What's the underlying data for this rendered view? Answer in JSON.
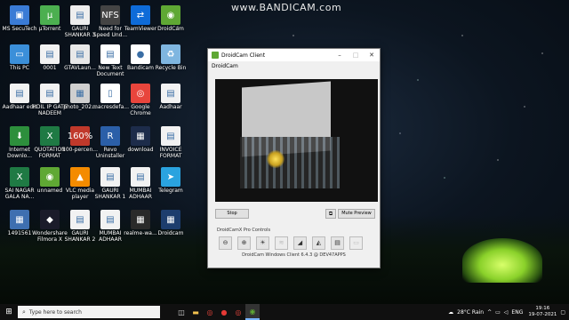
{
  "watermark": "www.BANDICAM.com",
  "desktop_icons": [
    {
      "label": "MS SecuTech",
      "icon": "ms-secutech-icon",
      "color": "#3a7bd5",
      "glyph": "▣"
    },
    {
      "label": "µTorrent",
      "icon": "utorrent-icon",
      "color": "#4caf50",
      "glyph": "µ"
    },
    {
      "label": "GAURI SHANKAR 3",
      "icon": "document-icon",
      "color": "#eeeeee",
      "glyph": "▤"
    },
    {
      "label": "Need for Speed Und...",
      "icon": "game-icon",
      "color": "#444444",
      "glyph": "NFS"
    },
    {
      "label": "TeamViewer",
      "icon": "teamviewer-icon",
      "color": "#0e6bd8",
      "glyph": "⇄"
    },
    {
      "label": "DroidCam",
      "icon": "droidcam-icon",
      "color": "#5fa834",
      "glyph": "◉"
    },
    {
      "label": "This PC",
      "icon": "computer-icon",
      "color": "#3b8fd9",
      "glyph": "▭"
    },
    {
      "label": "0001",
      "icon": "image-icon",
      "color": "#f2f2f2",
      "glyph": "▤"
    },
    {
      "label": "GTAVLaun...",
      "icon": "gtav-icon",
      "color": "#e8e8e8",
      "glyph": "▤"
    },
    {
      "label": "New Text Document",
      "icon": "text-file-icon",
      "color": "#ffffff",
      "glyph": "▤"
    },
    {
      "label": "Bandicam",
      "icon": "bandicam-icon",
      "color": "#ffffff",
      "glyph": "●"
    },
    {
      "label": "Recycle Bin",
      "icon": "recycle-bin-icon",
      "color": "#7fb6e0",
      "glyph": "♻"
    },
    {
      "label": "Aadhaar edit",
      "icon": "document-icon",
      "color": "#f2f2f2",
      "glyph": "▤"
    },
    {
      "label": "HDIL IP GATE NADEEM",
      "icon": "document-icon",
      "color": "#f2f2f2",
      "glyph": "▤"
    },
    {
      "label": "photo_202...",
      "icon": "photo-icon",
      "color": "#cfcfcf",
      "glyph": "▦"
    },
    {
      "label": "macresdefa...",
      "icon": "file-icon",
      "color": "#ffffff",
      "glyph": "▯"
    },
    {
      "label": "Google Chrome",
      "icon": "chrome-icon",
      "color": "#e8453c",
      "glyph": "◎"
    },
    {
      "label": "Aadhaar",
      "icon": "document-icon",
      "color": "#f2f2f2",
      "glyph": "▤"
    },
    {
      "label": "Internet Downlo...",
      "icon": "idm-icon",
      "color": "#2d8f3c",
      "glyph": "⬇"
    },
    {
      "label": "QUOTATION FORMAT",
      "icon": "excel-icon",
      "color": "#1f7a44",
      "glyph": "X"
    },
    {
      "label": "100-percen...",
      "icon": "image-icon",
      "color": "#c0392b",
      "glyph": "160%"
    },
    {
      "label": "Revo Uninstaller",
      "icon": "revo-icon",
      "color": "#2b5fa8",
      "glyph": "R"
    },
    {
      "label": "download",
      "icon": "image-icon",
      "color": "#1d2c4a",
      "glyph": "▦"
    },
    {
      "label": "INVOICE FORMAT",
      "icon": "document-icon",
      "color": "#f2f2f2",
      "glyph": "▤"
    },
    {
      "label": "SAI NAGAR GALA NA...",
      "icon": "excel-icon",
      "color": "#1f7a44",
      "glyph": "X"
    },
    {
      "label": "unnamed",
      "icon": "droidcam-icon",
      "color": "#5fa834",
      "glyph": "◉"
    },
    {
      "label": "VLC media player",
      "icon": "vlc-icon",
      "color": "#f48b00",
      "glyph": "▲"
    },
    {
      "label": "GAURI SHANKAR 1",
      "icon": "document-icon",
      "color": "#f2f2f2",
      "glyph": "▤"
    },
    {
      "label": "MUMBAI ADHAAR",
      "icon": "document-icon",
      "color": "#f2f2f2",
      "glyph": "▤"
    },
    {
      "label": "Telegram",
      "icon": "telegram-icon",
      "color": "#2aa3df",
      "glyph": "➤"
    },
    {
      "label": "1491561",
      "icon": "image-icon",
      "color": "#3e6fb0",
      "glyph": "▦"
    },
    {
      "label": "Wondershare Filmora X",
      "icon": "filmora-icon",
      "color": "#1b1b2a",
      "glyph": "◆"
    },
    {
      "label": "GAURI SHANKAR 2",
      "icon": "document-icon",
      "color": "#f2f2f2",
      "glyph": "▤"
    },
    {
      "label": "MUMBAI ADHAAR",
      "icon": "document-icon",
      "color": "#f2f2f2",
      "glyph": "▤"
    },
    {
      "label": "realme-wa...",
      "icon": "image-icon",
      "color": "#2a2a2a",
      "glyph": "▦"
    },
    {
      "label": "Droidcam",
      "icon": "image-icon",
      "color": "#1d3d6d",
      "glyph": "▦"
    }
  ],
  "droidcam": {
    "title": "DroidCam Client",
    "menu": "DroidCam",
    "stop_label": "Stop",
    "mute_label": "Mute Preview",
    "pro_controls_label": "DroidCamX Pro Controls",
    "tools": [
      {
        "name": "zoom-out-icon",
        "glyph": "⊖",
        "enabled": true
      },
      {
        "name": "zoom-in-icon",
        "glyph": "⊕",
        "enabled": true
      },
      {
        "name": "brightness-icon",
        "glyph": "☀",
        "enabled": true
      },
      {
        "name": "flash-icon",
        "glyph": "≋",
        "enabled": false
      },
      {
        "name": "autofocus-icon",
        "glyph": "◢",
        "enabled": true
      },
      {
        "name": "mirror-icon",
        "glyph": "◭",
        "enabled": true
      },
      {
        "name": "save-image-icon",
        "glyph": "▤",
        "enabled": true
      },
      {
        "name": "options-icon",
        "glyph": "▭",
        "enabled": false
      }
    ],
    "version": "DroidCam Windows Client 6.4.3 @ DEV47APPS"
  },
  "taskbar": {
    "search_placeholder": "Type here to search",
    "weather": "28°C Rain",
    "language": "ENG",
    "time": "19:16",
    "date": "19-07-2021"
  }
}
